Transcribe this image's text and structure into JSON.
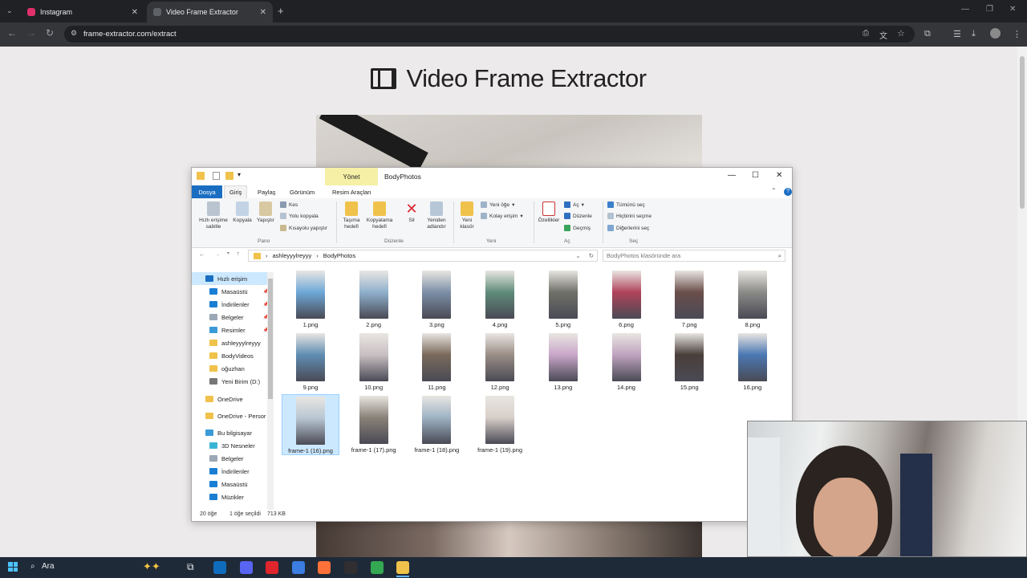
{
  "browser": {
    "tabs": [
      {
        "label": "Instagram",
        "color": "#e1306c"
      },
      {
        "label": "Video Frame Extractor",
        "color": "#5f6368"
      }
    ],
    "url": "frame-extractor.com/extract"
  },
  "page": {
    "title": "Video Frame Extractor"
  },
  "explorer": {
    "manage_tab": "Yönet",
    "window_title": "BodyPhotos",
    "menu": [
      "Dosya",
      "Giriş",
      "Paylaş",
      "Görünüm",
      "Resim Araçları"
    ],
    "ribbon": {
      "pin": "Hızlı erişime sabitle",
      "copy": "Kopyala",
      "paste": "Yapıştır",
      "cut": "Kes",
      "copy_path": "Yolu kopyala",
      "paste_shortcut": "Kısayolu yapıştır",
      "group_clipboard": "Pano",
      "move_to": "Taşıma hedefi",
      "copy_to": "Kopyalama hedefi",
      "delete": "Sil",
      "rename": "Yeniden adlandır",
      "group_organize": "Düzenle",
      "new_folder": "Yeni klasör",
      "new_item": "Yeni öğe",
      "easy_access": "Kolay erişim",
      "group_new": "Yeni",
      "properties": "Özellikler",
      "open": "Aç",
      "edit": "Düzenle",
      "history": "Geçmiş",
      "group_open": "Aç",
      "select_all": "Tümünü seç",
      "select_none": "Hiçbirini seçme",
      "invert": "Diğerlerini seç",
      "group_select": "Seç"
    },
    "path": [
      "ashleyyylreyyy",
      "BodyPhotos"
    ],
    "search_placeholder": "BodyPhotos klasöründe ara",
    "nav": [
      {
        "label": "Hızlı erişim",
        "color": "#1a6ec2",
        "pin": false
      },
      {
        "label": "Masaüstü",
        "color": "#1a7fd4",
        "pin": true
      },
      {
        "label": "İndirilenler",
        "color": "#1a7fd4",
        "pin": true
      },
      {
        "label": "Belgeler",
        "color": "#9aa7b5",
        "pin": true
      },
      {
        "label": "Resimler",
        "color": "#3b9bd6",
        "pin": true
      },
      {
        "label": "ashleyyylreyyy",
        "color": "#f0c24b",
        "pin": false
      },
      {
        "label": "BodyVideos",
        "color": "#f0c24b",
        "pin": false
      },
      {
        "label": "oğuzhan",
        "color": "#f0c24b",
        "pin": false
      },
      {
        "label": "Yeni Birim (D:)",
        "color": "#777777",
        "pin": false
      },
      {
        "label": "OneDrive",
        "color": "#f0c24b",
        "pin": false
      },
      {
        "label": "OneDrive - Persor",
        "color": "#f0c24b",
        "pin": false
      },
      {
        "label": "Bu bilgisayar",
        "color": "#3b9bd6",
        "pin": false
      },
      {
        "label": "3D Nesneler",
        "color": "#3bb5d6",
        "pin": false
      },
      {
        "label": "Belgeler",
        "color": "#9aa7b5",
        "pin": false
      },
      {
        "label": "İndirilenler",
        "color": "#1a7fd4",
        "pin": false
      },
      {
        "label": "Masaüstü",
        "color": "#1a7fd4",
        "pin": false
      },
      {
        "label": "Müzikler",
        "color": "#1a7fd4",
        "pin": false
      }
    ],
    "files": [
      {
        "name": "1.png",
        "color": "#6ea8d8"
      },
      {
        "name": "2.png",
        "color": "#8fb0cc"
      },
      {
        "name": "3.png",
        "color": "#7c8fa6"
      },
      {
        "name": "4.png",
        "color": "#5f8c7a"
      },
      {
        "name": "5.png",
        "color": "#6f7168"
      },
      {
        "name": "6.png",
        "color": "#b0435a"
      },
      {
        "name": "7.png",
        "color": "#6b4e4a"
      },
      {
        "name": "8.png",
        "color": "#8a8a88"
      },
      {
        "name": "9.png",
        "color": "#5f8db3"
      },
      {
        "name": "10.png",
        "color": "#c8bfc2"
      },
      {
        "name": "11.png",
        "color": "#7a6a5c"
      },
      {
        "name": "12.png",
        "color": "#9a8e86"
      },
      {
        "name": "13.png",
        "color": "#c9a6c9"
      },
      {
        "name": "14.png",
        "color": "#bfa3bf"
      },
      {
        "name": "15.png",
        "color": "#4a3e3a"
      },
      {
        "name": "16.png",
        "color": "#4b78b3"
      },
      {
        "name": "frame-1 (16).png",
        "color": "#b8c6d2"
      },
      {
        "name": "frame-1 (17).png",
        "color": "#8a8278"
      },
      {
        "name": "frame-1 (18).png",
        "color": "#9eb3c4"
      },
      {
        "name": "frame-1 (19).png",
        "color": "#d8cfc9"
      }
    ],
    "selected_index": 16,
    "status": {
      "count": "20 öğe",
      "selection": "1 öğe seçildi",
      "size": "713 KB"
    }
  },
  "taskbar": {
    "search": "Ara",
    "apps": [
      {
        "name": "outlook-icon",
        "color": "#0f6cbd"
      },
      {
        "name": "discord-icon",
        "color": "#5865f2"
      },
      {
        "name": "opera-icon",
        "color": "#e0252d"
      },
      {
        "name": "store-icon",
        "color": "#3b7de0"
      },
      {
        "name": "firefox-icon",
        "color": "#ff7139"
      },
      {
        "name": "obs-icon",
        "color": "#302e31"
      },
      {
        "name": "chrome-icon",
        "color": "#34a853"
      },
      {
        "name": "explorer-icon",
        "color": "#f0c24b"
      }
    ]
  }
}
